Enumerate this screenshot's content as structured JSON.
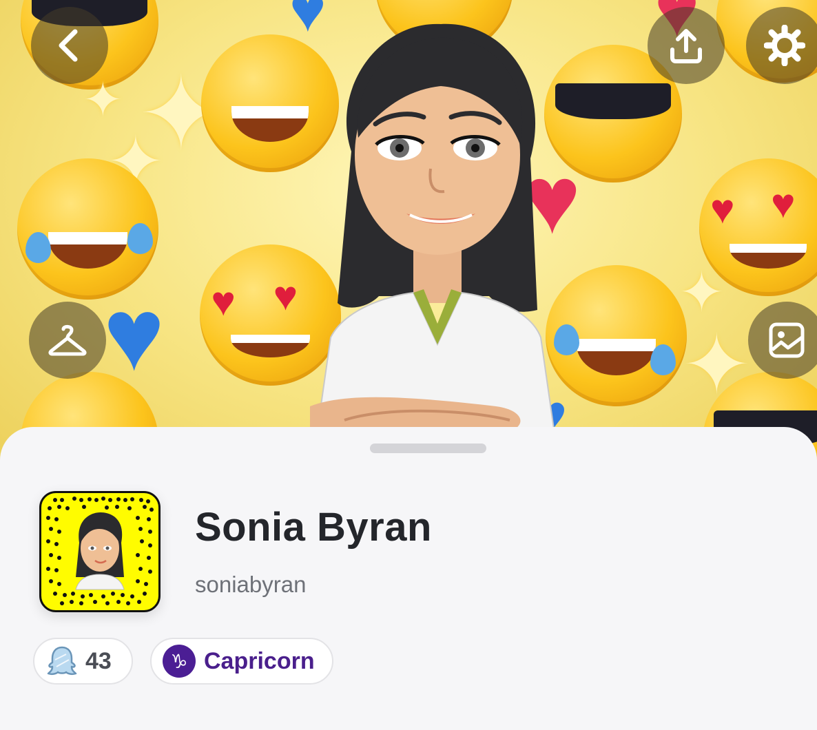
{
  "header": {
    "back_icon": "chevron-left-icon",
    "share_icon": "upload-icon",
    "settings_icon": "gear-icon",
    "outfit_icon": "hanger-icon",
    "background_icon": "image-icon"
  },
  "profile": {
    "display_name": "Sonia Byran",
    "username": "soniabyran",
    "snapscore": "43",
    "zodiac": "Capricorn",
    "zodiac_symbol": "♑"
  },
  "colors": {
    "snapcode_yellow": "#fffc00",
    "zodiac_purple": "#4b1e94",
    "text_dark": "#24262b",
    "text_muted": "#6e7178"
  }
}
